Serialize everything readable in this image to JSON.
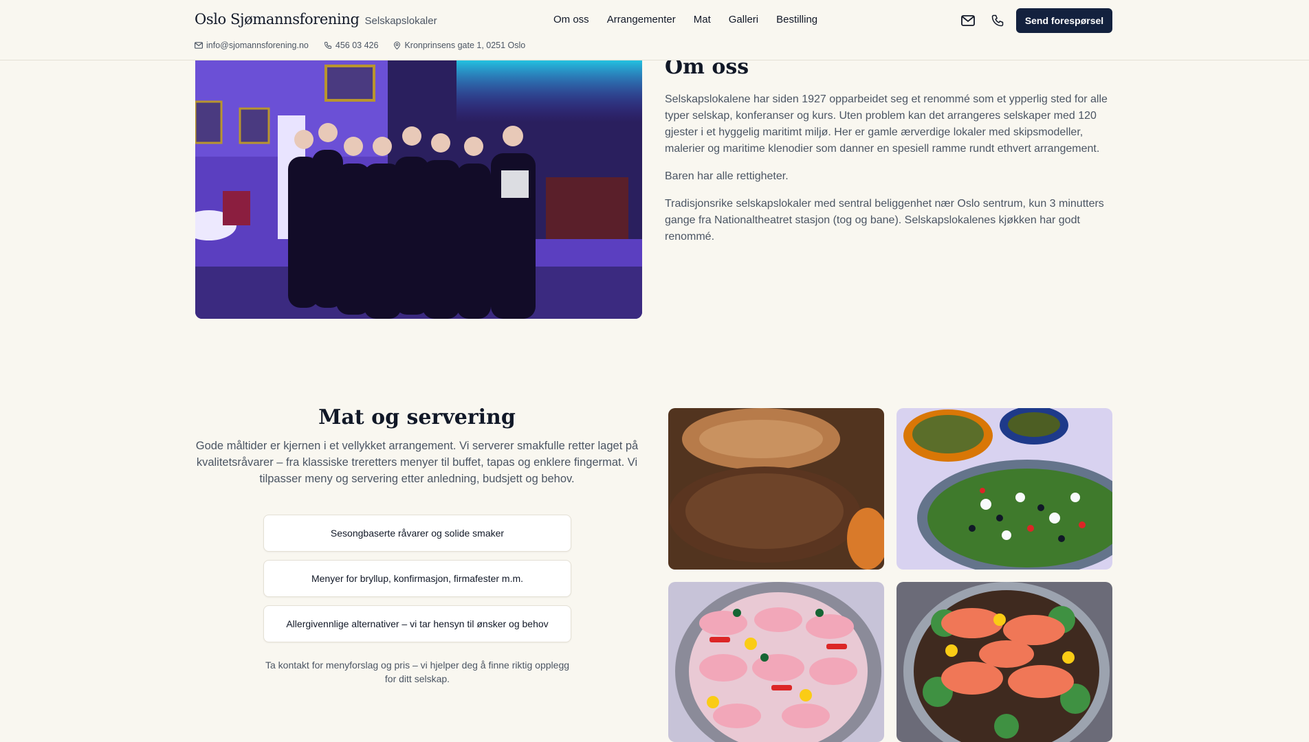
{
  "header": {
    "brand_name": "Oslo Sjømannsforening",
    "brand_sub": "Selskapslokaler",
    "nav": [
      "Om oss",
      "Arrangementer",
      "Mat",
      "Galleri",
      "Bestilling"
    ],
    "cta_label": "Send forespørsel",
    "contact": {
      "email": "info@sjomannsforening.no",
      "phone": "456 03 426",
      "address": "Kronprinsens gate 1, 0251 Oslo"
    }
  },
  "about": {
    "title": "Om oss",
    "paragraphs": [
      "Selskapslokalene har siden 1927 opparbeidet seg et renommé som et ypperlig sted for alle typer selskap, konferanser og kurs. Uten problem kan det arrangeres selskaper med 120 gjester i et hyggelig maritimt miljø. Her er gamle ærverdige lokaler med skipsmodeller, malerier og maritime klenodier som danner en spesiell ramme rundt ethvert arrangement.",
      "Baren har alle rettigheter.",
      "Tradisjonsrike selskapslokaler med sentral beliggenhet nær Oslo sentrum, kun 3 minutters gange fra Nationaltheatret stasjon (tog og bane). Selskapslokalenes kjøkken har godt renommé."
    ]
  },
  "food": {
    "title": "Mat og servering",
    "lead": "Gode måltider er kjernen i et vellykket arrangement. Vi serverer smakfulle retter laget på kvalitetsråvarer – fra klassiske treretters menyer til buffet, tapas og enklere fingermat. Vi tilpasser meny og servering etter anledning, budsjett og behov.",
    "features": [
      "Sesongbaserte råvarer og solide smaker",
      "Menyer for bryllup, konfirmasjon, firmafester m.m.",
      "Allergivennlige alternativer – vi tar hensyn til ønsker og behov"
    ],
    "note": "Ta kontakt for menyforslag og pris – vi hjelper deg å finne riktig opplegg for ditt selskap."
  }
}
